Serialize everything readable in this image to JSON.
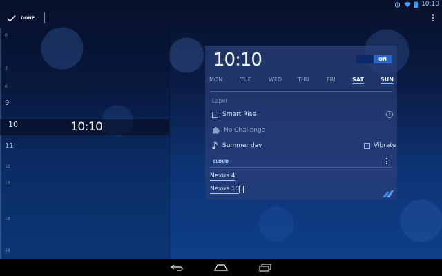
{
  "status_bar": {
    "time": "10:10"
  },
  "action_bar": {
    "done_label": "DONE"
  },
  "timeline": {
    "hour_marks": [
      {
        "label": "0",
        "size": "small"
      },
      {
        "label": "3",
        "size": "small"
      },
      {
        "label": "6",
        "size": "small"
      },
      {
        "label": "9",
        "size": "big"
      },
      {
        "label": "10",
        "size": "current"
      },
      {
        "label": "11",
        "size": "big"
      },
      {
        "label": "12",
        "size": "small"
      },
      {
        "label": "13",
        "size": "small"
      },
      {
        "label": "18",
        "size": "small"
      },
      {
        "label": "24",
        "size": "small"
      }
    ],
    "current_time": "10:10"
  },
  "alarm_card": {
    "time": "10:10",
    "toggle_label": "ON",
    "days": [
      {
        "label": "MON",
        "active": false
      },
      {
        "label": "TUE",
        "active": false
      },
      {
        "label": "WED",
        "active": false
      },
      {
        "label": "THU",
        "active": false
      },
      {
        "label": "FRI",
        "active": false
      },
      {
        "label": "SAT",
        "active": true
      },
      {
        "label": "SUN",
        "active": true
      }
    ],
    "label_placeholder": "Label",
    "smart_rise": "Smart Rise",
    "help_glyph": "?",
    "challenge": "No Challenge",
    "ringtone": "Summer day",
    "vibrate": "Vibrate",
    "cloud_section": "CLOUD",
    "devices": [
      "Nexus 4",
      "Nexus 10"
    ]
  },
  "colors": {
    "accent": "#2a67c8",
    "section_header": "#a9d0ff"
  }
}
